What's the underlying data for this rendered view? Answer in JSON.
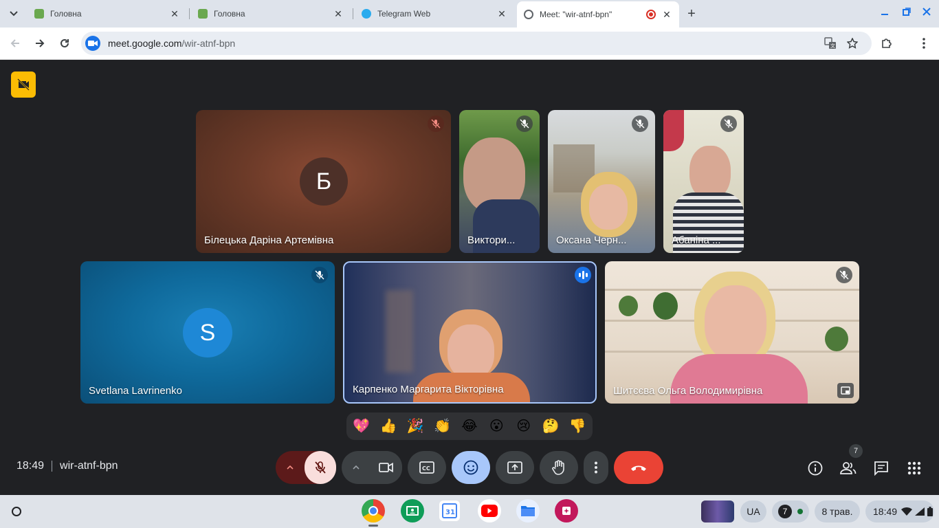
{
  "browser": {
    "tabs": [
      {
        "title": "Головна",
        "favicon": "school-icon",
        "active": false
      },
      {
        "title": "Головна",
        "favicon": "school-icon",
        "active": false
      },
      {
        "title": "Telegram Web",
        "favicon": "telegram-icon",
        "active": false
      },
      {
        "title": "Meet: \"wir-atnf-bpn\"",
        "favicon": "globe-icon",
        "active": true,
        "recording": true
      }
    ],
    "url_domain": "meet.google.com",
    "url_path": "/wir-atnf-bpn"
  },
  "meet": {
    "participants": [
      {
        "name": "Білецька Даріна Артемівна",
        "initial": "Б",
        "camera_on": false,
        "muted": true
      },
      {
        "name": "Виктори...",
        "camera_on": true,
        "muted": true
      },
      {
        "name": "Оксана Черн...",
        "camera_on": true,
        "muted": true
      },
      {
        "name": "Абаніна ...",
        "camera_on": true,
        "muted": true
      },
      {
        "name": "Svetlana Lavrinenko",
        "initial": "S",
        "camera_on": false,
        "muted": true
      },
      {
        "name": "Карпенко Маргарита Вікторівна",
        "camera_on": true,
        "muted": false,
        "speaking": true
      },
      {
        "name": "Шитєєва Ольга Володимирівна",
        "camera_on": true,
        "muted": true
      }
    ],
    "reactions": [
      "💖",
      "👍",
      "🎉",
      "👏",
      "😂",
      "😮",
      "😢",
      "🤔",
      "👎"
    ],
    "time": "18:49",
    "meeting_code": "wir-atnf-bpn",
    "participant_count": "7",
    "colors": {
      "end_call": "#ea4335",
      "mic_off_bg": "#f9dedc",
      "emoji_active_bg": "#a8c7fa",
      "warn": "#fbbc04"
    }
  },
  "shelf": {
    "apps": [
      "chrome-icon",
      "classroom-icon",
      "calendar-icon",
      "youtube-icon",
      "files-icon",
      "canvas-icon"
    ],
    "input_method": "UA",
    "notification_count": "7",
    "date": "8 трав.",
    "clock": "18:49"
  }
}
